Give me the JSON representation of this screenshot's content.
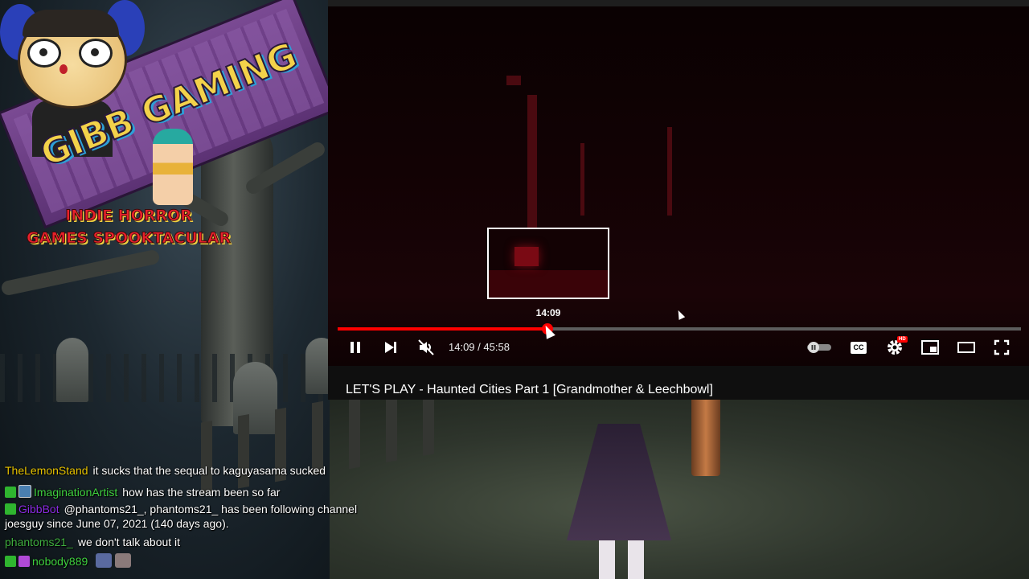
{
  "overlay": {
    "logo_title": "GIBB GAMING",
    "subtitle_line1": "INDIE HORROR",
    "subtitle_line2": "GAMES SPOOKTACULAR"
  },
  "player": {
    "hover_time": "14:09",
    "current_time": "14:09",
    "duration": "45:58",
    "time_separator": " / ",
    "progress_fraction": 0.307,
    "settings_badge": "HD",
    "cc_label": "CC",
    "title": "LET'S PLAY - Haunted Cities Part 1 [Grandmother & Leechbowl]",
    "colors": {
      "progress": "#ff0000",
      "track": "#5d5d5d"
    }
  },
  "chat": {
    "messages": [
      {
        "user": "TheLemonStand",
        "user_color": "#e6c200",
        "text": "it sucks that the sequal to kaguyasama sucked",
        "badges": []
      },
      {
        "user": "ImaginationArtist",
        "user_color": "#3fd13f",
        "text": "how has the stream been so far",
        "badges": [
          "check",
          "sub"
        ]
      },
      {
        "user": "GibbBot",
        "user_color": "#8a2be2",
        "text": "@phantoms21_, phantoms21_ has been following channel",
        "badges": [
          "check"
        ]
      },
      {
        "user": "",
        "user_color": "#ffffff",
        "text": "joesguy since June 07, 2021 (140 days ago).",
        "badges": []
      },
      {
        "user": "phantoms21_",
        "user_color": "#3fae3f",
        "text": "we don't talk about it",
        "badges": []
      },
      {
        "user": "nobody889",
        "user_color": "#3fd13f",
        "text": "",
        "badges": [
          "check",
          "prime"
        ]
      }
    ]
  }
}
